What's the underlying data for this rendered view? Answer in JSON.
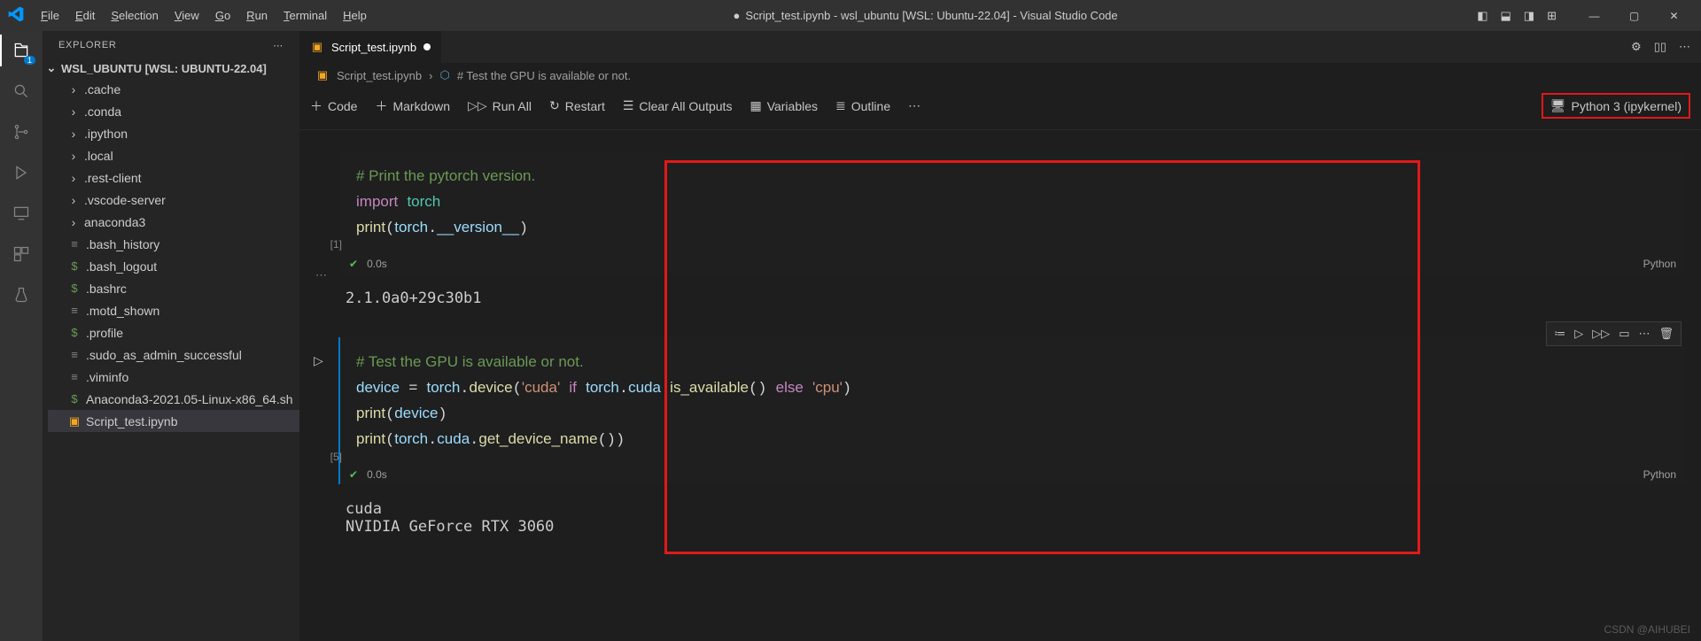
{
  "titlebar": {
    "menus": [
      "File",
      "Edit",
      "Selection",
      "View",
      "Go",
      "Run",
      "Terminal",
      "Help"
    ],
    "title": "Script_test.ipynb - wsl_ubuntu [WSL: Ubuntu-22.04] - Visual Studio Code"
  },
  "sidebar": {
    "header": "EXPLORER",
    "section": "WSL_UBUNTU [WSL: UBUNTU-22.04]",
    "items": [
      {
        "name": ".cache",
        "type": "folder"
      },
      {
        "name": ".conda",
        "type": "folder"
      },
      {
        "name": ".ipython",
        "type": "folder"
      },
      {
        "name": ".local",
        "type": "folder"
      },
      {
        "name": ".rest-client",
        "type": "folder"
      },
      {
        "name": ".vscode-server",
        "type": "folder"
      },
      {
        "name": "anaconda3",
        "type": "folder"
      },
      {
        "name": ".bash_history",
        "type": "file-lines"
      },
      {
        "name": ".bash_logout",
        "type": "file-dollar"
      },
      {
        "name": ".bashrc",
        "type": "file-dollar"
      },
      {
        "name": ".motd_shown",
        "type": "file-lines"
      },
      {
        "name": ".profile",
        "type": "file-dollar"
      },
      {
        "name": ".sudo_as_admin_successful",
        "type": "file-lines"
      },
      {
        "name": ".viminfo",
        "type": "file-lines"
      },
      {
        "name": "Anaconda3-2021.05-Linux-x86_64.sh",
        "type": "file-dollar"
      },
      {
        "name": "Script_test.ipynb",
        "type": "file-ipynb",
        "selected": true
      }
    ]
  },
  "tab": {
    "label": "Script_test.ipynb",
    "dirty": true
  },
  "breadcrumb": {
    "file": "Script_test.ipynb",
    "cell": "# Test the GPU is available or not."
  },
  "toolbar": {
    "code": "Code",
    "markdown": "Markdown",
    "run_all": "Run All",
    "restart": "Restart",
    "clear": "Clear All Outputs",
    "variables": "Variables",
    "outline": "Outline",
    "kernel": "Python 3 (ipykernel)"
  },
  "cells": [
    {
      "exec_count": "[1]",
      "status_time": "0.0s",
      "lang": "Python",
      "code_html": "<span class='tok-comment'># Print the pytorch version.</span>\n<span class='tok-kw'>import</span> <span class='tok-mod'>torch</span>\n<span class='tok-fn'>print</span>(<span class='tok-var'>torch</span>.<span class='tok-var'>__version__</span>)",
      "output": "2.1.0a0+29c30b1"
    },
    {
      "exec_count": "[5]",
      "status_time": "0.0s",
      "lang": "Python",
      "focused": true,
      "code_html": "<span class='tok-comment'># Test the GPU is available or not.</span>\n<span class='tok-var'>device</span> <span class='tok-op'>=</span> <span class='tok-var'>torch</span>.<span class='tok-fn'>device</span>(<span class='tok-str'>'cuda'</span> <span class='tok-kw'>if</span> <span class='tok-var'>torch</span>.<span class='tok-var'>cuda</span>.<span class='tok-fn'>is_available</span>() <span class='tok-kw'>else</span> <span class='tok-str'>'cpu'</span>)\n<span class='tok-fn'>print</span>(<span class='tok-var'>device</span>)\n<span class='tok-fn'>print</span>(<span class='tok-var'>torch</span>.<span class='tok-var'>cuda</span>.<span class='tok-fn'>get_device_name</span>())",
      "output": "cuda\nNVIDIA GeForce RTX 3060"
    }
  ],
  "watermark": "CSDN @AIHUBEI"
}
